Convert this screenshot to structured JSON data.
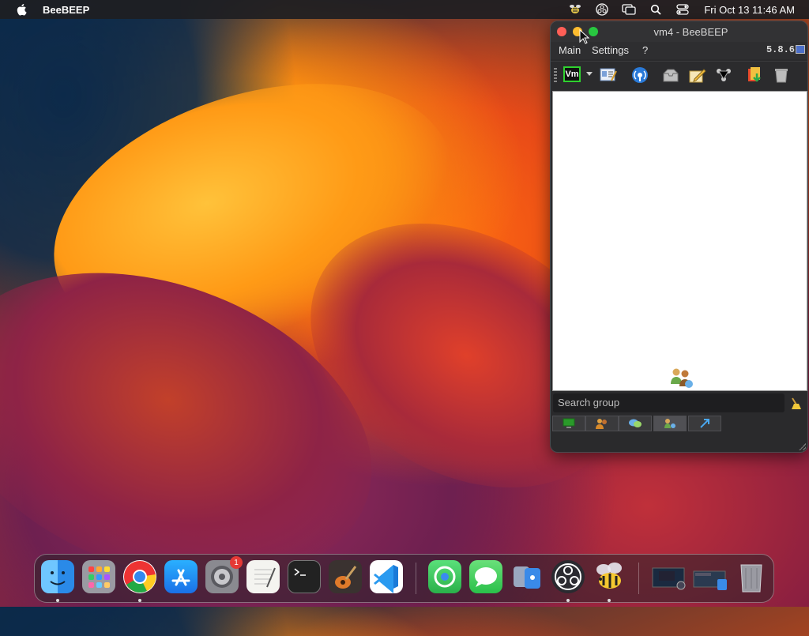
{
  "menubar": {
    "app_name": "BeeBEEP",
    "clock": "Fri Oct 13  11:46 AM",
    "icons": [
      "apple-icon",
      "beebeep-status-icon",
      "obs-status-icon",
      "screen-mirroring-icon",
      "spotlight-search-icon",
      "control-center-icon"
    ]
  },
  "window": {
    "title": "vm4 - BeeBEEP",
    "menu": [
      "Main",
      "Settings",
      "?"
    ],
    "version": "5.8.6",
    "toolbar": {
      "status_label": "Vm",
      "icons": [
        "profile-card-icon",
        "broadcast-icon",
        "inbox-icon",
        "write-note-icon",
        "network-plugins-icon",
        "file-share-icon",
        "trash-icon"
      ]
    },
    "search": {
      "placeholder": "Search group"
    },
    "tabs": [
      "users-tab",
      "groups-tab",
      "chats-tab",
      "group-members-tab",
      "file-transfer-tab"
    ],
    "active_tab": "group-members-tab"
  },
  "dock": {
    "apps": [
      "Finder",
      "Launchpad",
      "Google Chrome",
      "App Store",
      "System Settings",
      "TextEdit",
      "Terminal",
      "GarageBand",
      "Visual Studio Code",
      "Find My",
      "Messages",
      "Migration Assistant",
      "OBS",
      "BeeBEEP",
      "Screenshot Preview",
      "Minimized Window",
      "Trash"
    ],
    "badge": "1"
  },
  "colors": {
    "accent_green": "#2fd12f",
    "close": "#ff5f57",
    "minimize": "#febc2e",
    "maximize": "#28c840"
  }
}
